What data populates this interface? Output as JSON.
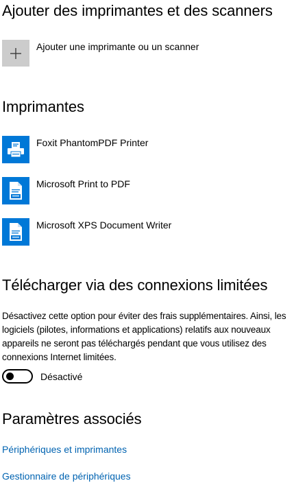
{
  "add_section": {
    "heading": "Ajouter des imprimantes et des scanners",
    "add_button_label": "Ajouter une imprimante ou un scanner",
    "add_icon": "plus-icon"
  },
  "printers_section": {
    "heading": "Imprimantes",
    "items": [
      {
        "label": "Foxit PhantomPDF Printer",
        "icon": "printer-icon"
      },
      {
        "label": "Microsoft Print to PDF",
        "icon": "document-printer-icon"
      },
      {
        "label": "Microsoft XPS Document Writer",
        "icon": "document-printer-icon"
      }
    ]
  },
  "metered_section": {
    "heading": "Télécharger via des connexions limitées",
    "description": "Désactivez cette option pour éviter des frais supplémentaires. Ainsi, les logiciels (pilotes, informations et applications) relatifs aux nouveaux appareils ne seront pas téléchargés pendant que vous utilisez des connexions Internet limitées.",
    "toggle_state": "off",
    "toggle_label": "Désactivé"
  },
  "related_section": {
    "heading": "Paramètres associés",
    "links": [
      "Périphériques et imprimantes",
      "Gestionnaire de périphériques"
    ]
  },
  "colors": {
    "accent": "#0078d7",
    "link": "#0063b1",
    "tile_gray": "#cccccc"
  }
}
